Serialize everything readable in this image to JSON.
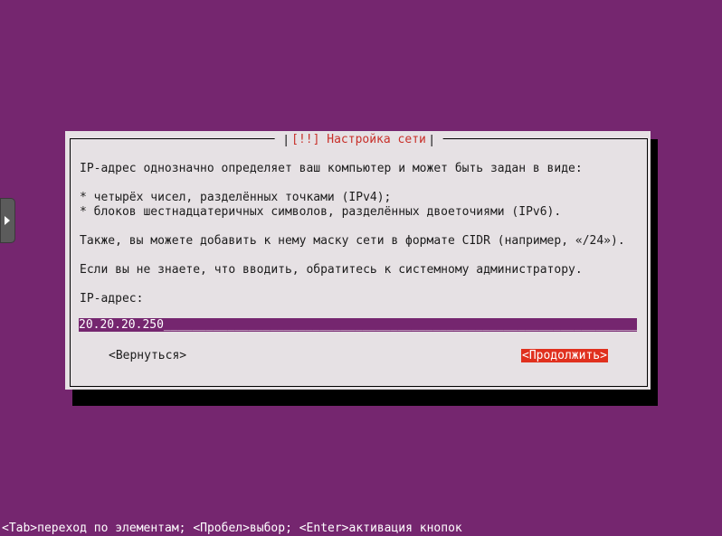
{
  "dialog": {
    "title": "[!!] Настройка сети",
    "intro": "IP-адрес однозначно определяет ваш компьютер и может быть задан в виде:",
    "bullets": [
      "* четырёх чисел, разделённых точками (IPv4);",
      "* блоков шестнадцатеричных символов, разделённых двоеточиями (IPv6)."
    ],
    "cidr_note": "Также, вы можете добавить к нему маску сети в формате CIDR (например, «/24»).",
    "admin_note": "Если вы не знаете, что вводить, обратитесь к системному администратору.",
    "field_label": "IP-адрес:",
    "field_value": "20.20.20.250",
    "field_fill": "____________________________________________________________________________",
    "back_label": "<Вернуться>",
    "continue_label": "<Продолжить>"
  },
  "help_bar": "<Tab>переход по элементам; <Пробел>выбор; <Enter>активация кнопок",
  "side_tab": {
    "icon": "play-arrow-icon"
  },
  "colors": {
    "background": "#75266f",
    "dialog_bg": "#e6e1e4",
    "title": "#c8302a",
    "selected_button": "#e0301e",
    "input_bg": "#75266f"
  }
}
